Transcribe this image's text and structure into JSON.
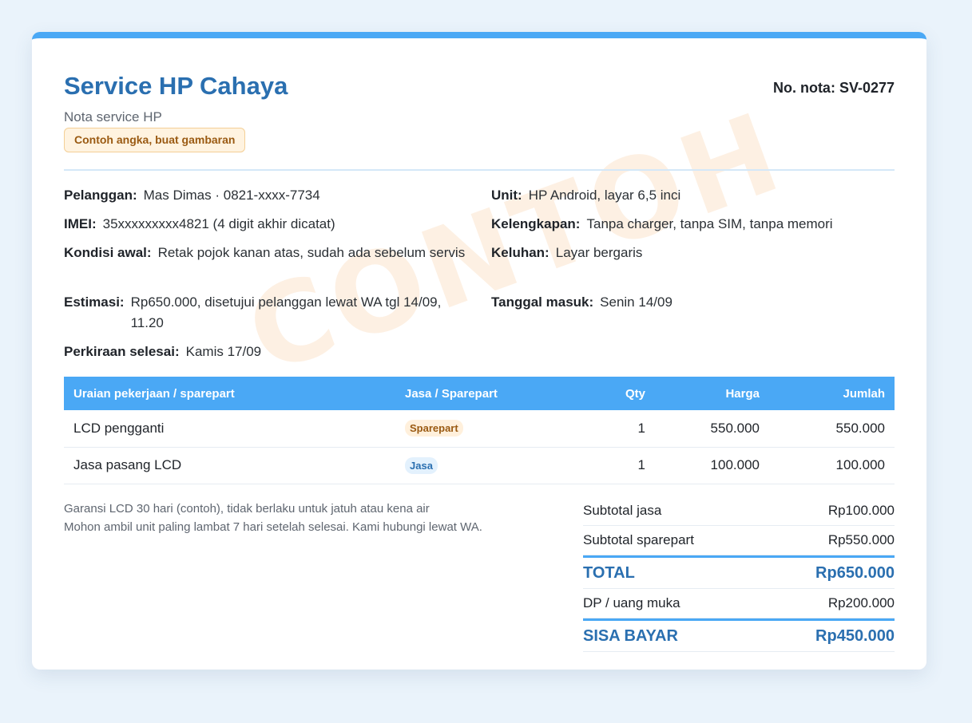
{
  "shop": {
    "name": "Service HP Cahaya",
    "subtitle": "Nota service HP",
    "sample_badge": "Contoh angka, buat gambaran",
    "nota_number": "No. nota: SV-0277"
  },
  "watermark": "CONTOH",
  "info": {
    "pelanggan": {
      "label": "Pelanggan:",
      "value": "Mas Dimas · 0821-xxxx-7734"
    },
    "unit": {
      "label": "Unit:",
      "value": "HP Android, layar 6,5 inci"
    },
    "imei": {
      "label": "IMEI:",
      "value": "35xxxxxxxxx4821 (4 digit akhir dicatat)"
    },
    "kelengkapan": {
      "label": "Kelengkapan:",
      "value": "Tanpa charger, tanpa SIM, tanpa memori"
    },
    "kondisi": {
      "label": "Kondisi awal:",
      "value": "Retak pojok kanan atas, sudah ada sebelum servis"
    },
    "keluhan": {
      "label": "Keluhan:",
      "value": "Layar bergaris"
    },
    "estimasi": {
      "label": "Estimasi:",
      "value": "Rp650.000, disetujui pelanggan lewat WA tgl 14/09, 11.20"
    },
    "tanggal_masuk": {
      "label": "Tanggal masuk:",
      "value": "Senin 14/09"
    },
    "perkiraan": {
      "label": "Perkiraan selesai:",
      "value": "Kamis 17/09"
    }
  },
  "table": {
    "headers": [
      "Uraian pekerjaan / sparepart",
      "Jasa / Sparepart",
      "Qty",
      "Harga",
      "Jumlah"
    ],
    "rows": [
      {
        "desc": "LCD pengganti",
        "type": "Sparepart",
        "qty": "1",
        "price": "550.000",
        "amount": "550.000"
      },
      {
        "desc": "Jasa pasang LCD",
        "type": "Jasa",
        "qty": "1",
        "price": "100.000",
        "amount": "100.000"
      }
    ]
  },
  "notes": [
    "Garansi LCD 30 hari (contoh), tidak berlaku untuk jatuh atau kena air",
    "Mohon ambil unit paling lambat 7 hari setelah selesai. Kami hubungi lewat WA."
  ],
  "totals": {
    "subtotal_jasa": {
      "label": "Subtotal jasa",
      "value": "Rp100.000"
    },
    "subtotal_sparepart": {
      "label": "Subtotal sparepart",
      "value": "Rp550.000"
    },
    "total": {
      "label": "TOTAL",
      "value": "Rp650.000"
    },
    "dp": {
      "label": "DP / uang muka",
      "value": "Rp200.000"
    },
    "sisa": {
      "label": "SISA BAYAR",
      "value": "Rp450.000"
    }
  },
  "colors": {
    "accent": "#4aa8f5",
    "title": "#2a6fb0",
    "background": "#eaf3fb"
  }
}
